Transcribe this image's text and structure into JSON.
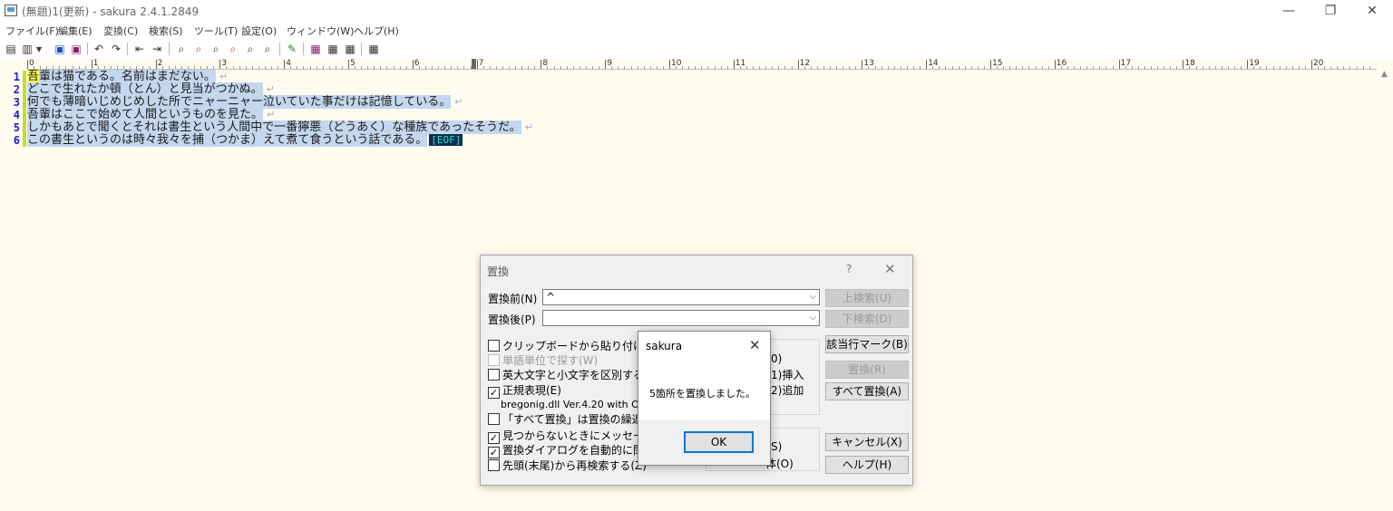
{
  "window": {
    "title": "(無題)1(更新) - sakura 2.4.1.2849",
    "min_glyph": "—",
    "max_glyph": "❐",
    "close_glyph": "✕"
  },
  "menu": [
    "ファイル(F)",
    "編集(E)",
    "変換(C)",
    "検索(S)",
    "ツール(T)",
    "設定(O)",
    "ウィンドウ(W)",
    "ヘルプ(H)"
  ],
  "toolbar": {
    "icons": [
      "new-file-icon",
      "open-file-icon",
      "dropdown-arrow-icon",
      "save-icon",
      "save-all-icon",
      "undo-icon",
      "redo-icon",
      "jump-back-icon",
      "jump-forward-icon",
      "find-icon",
      "find-next-icon",
      "find-prev-icon",
      "replace-icon",
      "grep-icon",
      "grep-replace-icon",
      "mark-icon",
      "outline-icon",
      "compare-icon",
      "bookmark-icon",
      "settings-icon"
    ],
    "glyphs": [
      "▤",
      "▥",
      "▾",
      "▣",
      "▣",
      "↶",
      "↷",
      "⇤",
      "⇥",
      "⌕",
      "⌕",
      "⌕",
      "⌕",
      "⌕",
      "⌕",
      "✎",
      "▦",
      "▦",
      "▦",
      "▦"
    ]
  },
  "editor": {
    "ruler_labels": [
      "0",
      "1",
      "2",
      "3",
      "4",
      "5",
      "6",
      "7",
      "8",
      "9",
      "10",
      "11",
      "12",
      "13",
      "14",
      "15",
      "16",
      "17",
      "18",
      "19",
      "20"
    ],
    "lines": [
      {
        "no": "1",
        "first": "吾",
        "text": "輩は猫である。名前はまだない。",
        "eol": "↵"
      },
      {
        "no": "2",
        "first": "",
        "text": "どこで生れたか頓（とん）と見当がつかぬ。",
        "eol": "↵"
      },
      {
        "no": "3",
        "first": "",
        "text": "何でも薄暗いじめじめした所でニャーニャー泣いていた事だけは記憶している。",
        "eol": "↵"
      },
      {
        "no": "4",
        "first": "",
        "text": "吾輩はここで始めて人間というものを見た。",
        "eol": "↵"
      },
      {
        "no": "5",
        "first": "",
        "text": "しかもあとで聞くとそれは書生という人間中で一番獰悪（どうあく）な種族であったそうだ。",
        "eol": "↵"
      },
      {
        "no": "6",
        "first": "",
        "text": "この書生というのは時々我々を捕（つかま）えて煮て食うという話である。",
        "eol": "[EOF]"
      }
    ]
  },
  "replace_dialog": {
    "title": "置換",
    "help": "?",
    "close": "✕",
    "before_label": "置換前(N)",
    "before_value": "^",
    "after_label": "置換後(P)",
    "after_value": "",
    "arrow": "⌵",
    "search_up": "上検索(U)",
    "search_down": "下検索(D)",
    "mark_lines": "該当行マーク(B)",
    "replace": "置換(R)",
    "replace_all": "すべて置換(A)",
    "cancel": "キャンセル(X)",
    "help_btn": "ヘルプ(H)",
    "options": [
      {
        "label": "クリップボードから貼り付ける(",
        "checked": false,
        "disabled": false
      },
      {
        "label": "単語単位で探す(W)",
        "checked": false,
        "disabled": true
      },
      {
        "label": "英大文字と小文字を区別する(",
        "checked": false,
        "disabled": false
      },
      {
        "label": "正規表現(E)",
        "checked": true,
        "disabled": false
      },
      {
        "label": "「すべて置換」は置換の繰返し",
        "checked": false,
        "disabled": false
      },
      {
        "label": "見つからないときにメッセージ",
        "checked": true,
        "disabled": false
      },
      {
        "label": "置換ダイアログを自動的に閉",
        "checked": true,
        "disabled": false
      },
      {
        "label": "先頭(末尾)から再検索する(Z)",
        "checked": false,
        "disabled": false
      }
    ],
    "regex_lib": "bregonig.dll Ver.4.20 with Oni",
    "partial_0": "0)",
    "partial_insert": "1)挿入",
    "partial_add": "2)追加",
    "partial_s": "S)",
    "partial_all": "体(O)"
  },
  "message_box": {
    "title": "sakura",
    "close": "✕",
    "text": "5箇所を置換しました。",
    "ok": "OK"
  }
}
